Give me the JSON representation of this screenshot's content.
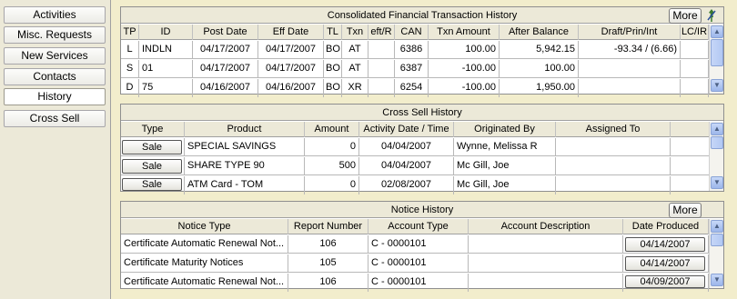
{
  "nav": {
    "items": [
      {
        "label": "Activities"
      },
      {
        "label": "Misc. Requests"
      },
      {
        "label": "New Services"
      },
      {
        "label": "Contacts"
      },
      {
        "label": "History",
        "active": true
      },
      {
        "label": "Cross Sell"
      }
    ]
  },
  "transactions": {
    "title": "Consolidated Financial Transaction History",
    "more_label": "More",
    "columns": [
      "TP",
      "ID",
      "Post Date",
      "Eff Date",
      "TL",
      "Txn",
      "eft/R",
      "CAN",
      "Txn Amount",
      "After Balance",
      "Draft/Prin/Int",
      "LC/IR"
    ],
    "rows": [
      [
        "L",
        "INDLN",
        "04/17/2007",
        "04/17/2007",
        "BO",
        "AT",
        "",
        "6386",
        "100.00",
        "5,942.15",
        "-93.34 / (6.66)",
        ""
      ],
      [
        "S",
        "01",
        "04/17/2007",
        "04/17/2007",
        "BO",
        "AT",
        "",
        "6387",
        "-100.00",
        "100.00",
        "",
        ""
      ],
      [
        "D",
        "75",
        "04/16/2007",
        "04/16/2007",
        "BO",
        "XR",
        "",
        "6254",
        "-100.00",
        "1,950.00",
        "",
        ""
      ]
    ]
  },
  "cross_sell": {
    "title": "Cross Sell History",
    "columns": [
      "Type",
      "Product",
      "Amount",
      "Activity Date / Time",
      "Originated By",
      "Assigned To"
    ],
    "rows": [
      {
        "type": "Sale",
        "product": "SPECIAL SAVINGS",
        "amount": "0",
        "date": "04/04/2007",
        "originated_by": "Wynne, Melissa R",
        "assigned_to": ""
      },
      {
        "type": "Sale",
        "product": "SHARE TYPE 90",
        "amount": "500",
        "date": "04/04/2007",
        "originated_by": "Mc Gill, Joe",
        "assigned_to": ""
      },
      {
        "type": "Sale",
        "product": "ATM Card - TOM",
        "amount": "0",
        "date": "02/08/2007",
        "originated_by": "Mc Gill, Joe",
        "assigned_to": ""
      }
    ]
  },
  "notices": {
    "title": "Notice History",
    "more_label": "More",
    "columns": [
      "Notice Type",
      "Report Number",
      "Account Type",
      "Account Description",
      "Date Produced"
    ],
    "rows": [
      {
        "notice_type": "Certificate Automatic Renewal Not...",
        "report_number": "106",
        "account_type": "C - 0000101",
        "account_description": "",
        "date_produced": "04/14/2007"
      },
      {
        "notice_type": "Certificate Maturity Notices",
        "report_number": "105",
        "account_type": "C - 0000101",
        "account_description": "",
        "date_produced": "04/14/2007"
      },
      {
        "notice_type": "Certificate Automatic Renewal Not...",
        "report_number": "106",
        "account_type": "C - 0000101",
        "account_description": "",
        "date_produced": "04/09/2007"
      }
    ]
  },
  "colors": {
    "content_bg": "#f2edcc",
    "chrome": "#ece9d8",
    "scroll_accent": "#9cb6ea"
  },
  "icons": {
    "pin": "pin-icon",
    "scroll_up": "arrow-up-icon",
    "scroll_down": "arrow-down-icon"
  }
}
